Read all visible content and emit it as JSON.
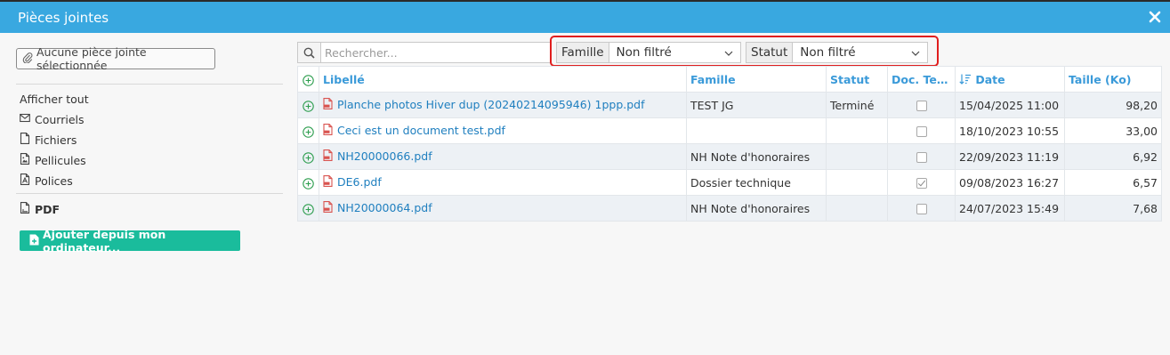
{
  "window": {
    "title": "Pièces jointes"
  },
  "sidebar": {
    "none_selected_label": "Aucune pièce jointe sélectionnée",
    "show_all": "Afficher tout",
    "items": [
      {
        "label": "Courriels",
        "icon": "envelope-icon"
      },
      {
        "label": "Fichiers",
        "icon": "file-icon"
      },
      {
        "label": "Pellicules",
        "icon": "image-file-icon"
      },
      {
        "label": "Polices",
        "icon": "font-file-icon"
      }
    ],
    "pdf_label": "PDF",
    "add_button": "Ajouter depuis mon ordinateur..."
  },
  "search": {
    "placeholder": "Rechercher..."
  },
  "filters": {
    "famille": {
      "label": "Famille",
      "value": "Non filtré"
    },
    "statut": {
      "label": "Statut",
      "value": "Non filtré"
    }
  },
  "table": {
    "columns": {
      "libelle": "Libellé",
      "famille": "Famille",
      "statut": "Statut",
      "doc_tech": "Doc. Tech.",
      "date": "Date",
      "taille": "Taille (Ko)"
    },
    "rows": [
      {
        "libelle": "Planche photos Hiver dup (20240214095946) 1ppp.pdf",
        "famille": "TEST JG",
        "statut": "Terminé",
        "doc_tech": false,
        "date": "15/04/2025 11:00",
        "taille": "98,20"
      },
      {
        "libelle": "Ceci est un document test.pdf",
        "famille": "",
        "statut": "",
        "doc_tech": false,
        "date": "18/10/2023 10:55",
        "taille": "33,00"
      },
      {
        "libelle": "NH20000066.pdf",
        "famille": "NH Note d'honoraires",
        "statut": "",
        "doc_tech": false,
        "date": "22/09/2023 11:19",
        "taille": "6,92"
      },
      {
        "libelle": "DE6.pdf",
        "famille": "Dossier technique",
        "statut": "",
        "doc_tech": true,
        "date": "09/08/2023 16:27",
        "taille": "6,57"
      },
      {
        "libelle": "NH20000064.pdf",
        "famille": "NH Note d'honoraires",
        "statut": "",
        "doc_tech": false,
        "date": "24/07/2023 15:49",
        "taille": "7,68"
      }
    ]
  },
  "colors": {
    "titlebar": "#39a8e0",
    "accent_link": "#1f7fbf",
    "add_button": "#1abc9c",
    "highlight_box": "#e01e1e",
    "add_row_icon": "#2e9e4f",
    "pdf_icon": "#d9534f"
  }
}
